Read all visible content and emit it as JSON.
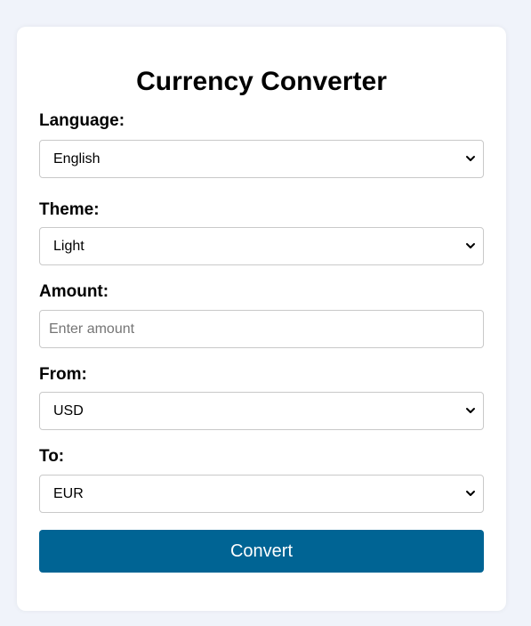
{
  "converter": {
    "title": "Currency Converter",
    "language": {
      "label": "Language:",
      "value": "English"
    },
    "theme": {
      "label": "Theme:",
      "value": "Light"
    },
    "amount": {
      "label": "Amount:",
      "placeholder": "Enter amount",
      "value": ""
    },
    "from": {
      "label": "From:",
      "value": "USD"
    },
    "to": {
      "label": "To:",
      "value": "EUR"
    },
    "convert_label": "Convert"
  },
  "colors": {
    "page_background": "#f0f3fa",
    "card_background": "#ffffff",
    "button_background": "#006494",
    "button_text": "#ffffff"
  },
  "icons": {
    "select_arrow": "chevron-down-icon"
  }
}
